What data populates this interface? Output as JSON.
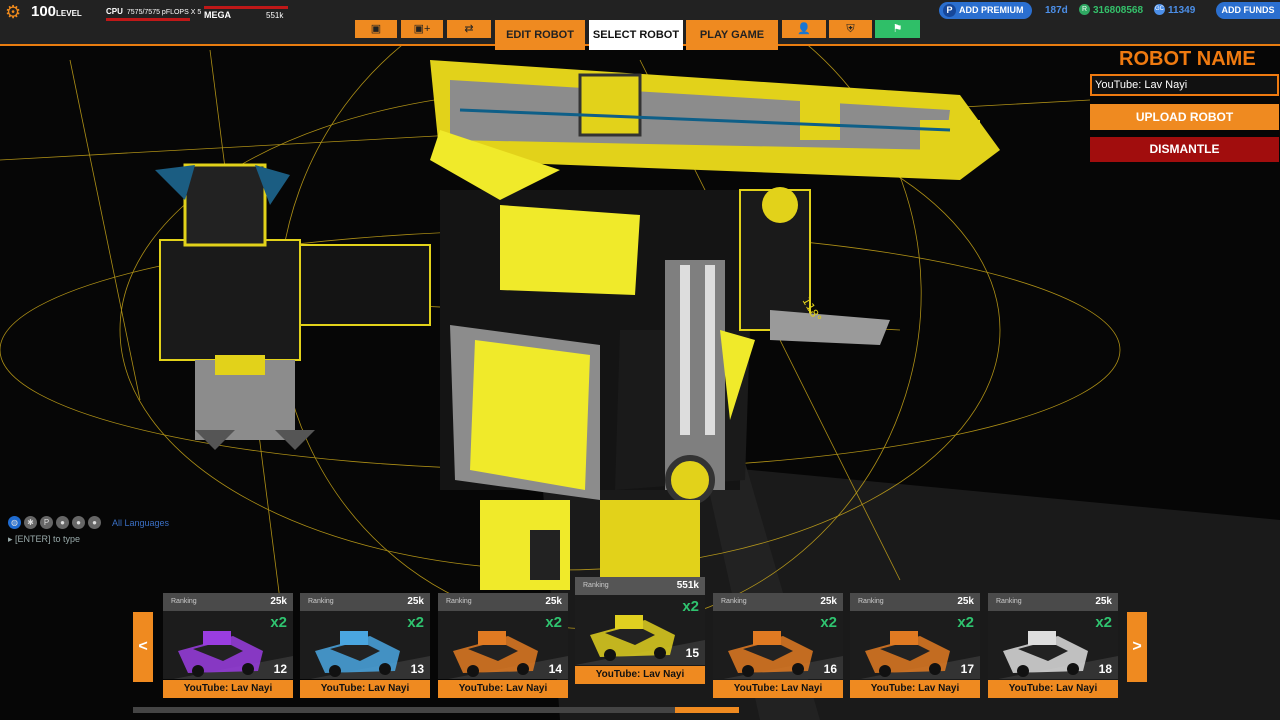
{
  "status": {
    "level": "100",
    "level_unit": "LEVEL",
    "cpu_label": "CPU",
    "cpu_value": "7575/7575 pFLOPS X 5",
    "mega_label": "MEGA",
    "mega_value": "551k"
  },
  "account": {
    "premium_label": "ADD PREMIUM",
    "premium_days": "187d",
    "robits": "316808568",
    "galaxy_coins": "11349",
    "funds_label": "ADD FUNDS"
  },
  "tabs": {
    "edit": "EDIT ROBOT",
    "select": "SELECT ROBOT",
    "play": "PLAY GAME"
  },
  "robot_panel": {
    "title": "ROBOT NAME",
    "name_value": "YouTube: Lav Nayi",
    "upload_label": "UPLOAD ROBOT",
    "dismantle_label": "DISMANTLE"
  },
  "chat": {
    "language": "All Languages",
    "prompt": "[ENTER] to type"
  },
  "robot_cards": [
    {
      "ranking": "Ranking",
      "score": "25k",
      "multiplier": "x2",
      "slot": "12",
      "name": "YouTube: Lav Nayi",
      "tint": "#9a3de0"
    },
    {
      "ranking": "Ranking",
      "score": "25k",
      "multiplier": "x2",
      "slot": "13",
      "name": "YouTube: Lav Nayi",
      "tint": "#4aa6e0"
    },
    {
      "ranking": "Ranking",
      "score": "25k",
      "multiplier": "x2",
      "slot": "14",
      "name": "YouTube: Lav Nayi",
      "tint": "#e07a22"
    },
    {
      "ranking": "Ranking",
      "score": "551k",
      "multiplier": "x2",
      "slot": "15",
      "name": "YouTube: Lav Nayi",
      "tint": "#e0d020"
    },
    {
      "ranking": "Ranking",
      "score": "25k",
      "multiplier": "x2",
      "slot": "16",
      "name": "YouTube: Lav Nayi",
      "tint": "#e07a22"
    },
    {
      "ranking": "Ranking",
      "score": "25k",
      "multiplier": "x2",
      "slot": "17",
      "name": "YouTube: Lav Nayi",
      "tint": "#e07a22"
    },
    {
      "ranking": "Ranking",
      "score": "25k",
      "multiplier": "x2",
      "slot": "18",
      "name": "YouTube: Lav Nayi",
      "tint": "#dddddd"
    }
  ],
  "colors": {
    "accent": "#ef8a20",
    "danger": "#a10d0d",
    "robot_yellow": "#f2e21a",
    "premium_blue": "#2b6fcf"
  }
}
